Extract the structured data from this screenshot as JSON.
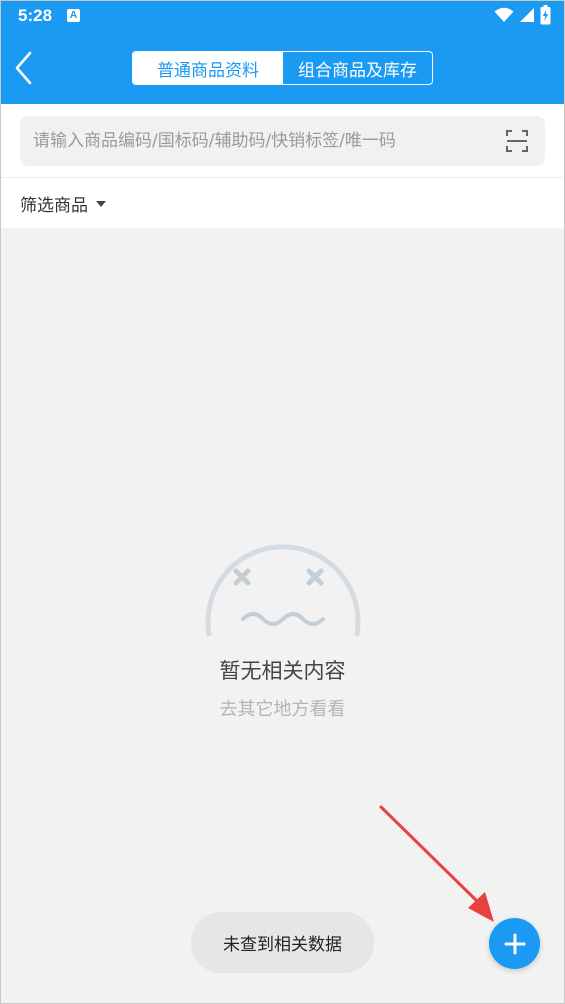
{
  "status_bar": {
    "time": "5:28",
    "notification_letter": "A",
    "icons": [
      "wifi-icon",
      "signal-icon",
      "battery-charging-icon"
    ]
  },
  "header": {
    "back_icon": "chevron-left-icon",
    "tabs": [
      {
        "label": "普通商品资料",
        "active": true
      },
      {
        "label": "组合商品及库存",
        "active": false
      }
    ]
  },
  "search": {
    "placeholder": "请输入商品编码/国标码/辅助码/快销标签/唯一码",
    "value": "",
    "scan_icon": "scan-icon"
  },
  "filter": {
    "label": "筛选商品",
    "icon": "caret-down-icon"
  },
  "empty_state": {
    "icon": "sad-face-icon",
    "title": "暂无相关内容",
    "subtitle": "去其它地方看看"
  },
  "toast": {
    "message": "未查到相关数据"
  },
  "fab": {
    "icon": "plus-icon"
  },
  "colors": {
    "primary": "#1a9af3",
    "background": "#f2f2f2",
    "annotation_arrow": "#e8423f"
  }
}
